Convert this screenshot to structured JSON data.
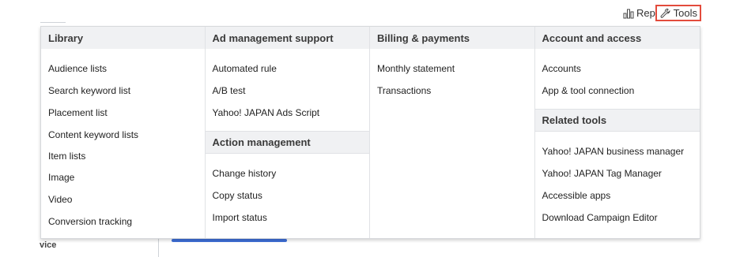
{
  "topbar": {
    "reports_label": "Reports",
    "tools_label": "Tools",
    "accent_color": "#e34b3c"
  },
  "background": {
    "bottom_fragment": "vice"
  },
  "menu": {
    "library": {
      "header": "Library",
      "items": [
        "Audience lists",
        "Search keyword list",
        "Placement list",
        "Content keyword lists",
        "Item lists",
        "Image",
        "Video",
        "Conversion tracking"
      ]
    },
    "ad_management": {
      "header": "Ad management support",
      "items": [
        "Automated rule",
        "A/B test",
        "Yahoo! JAPAN Ads Script"
      ],
      "sub_header": "Action management",
      "sub_items": [
        "Change history",
        "Copy status",
        "Import status"
      ]
    },
    "billing": {
      "header": "Billing & payments",
      "items": [
        "Monthly statement",
        "Transactions"
      ]
    },
    "account": {
      "header": "Account and access",
      "items": [
        "Accounts",
        "App & tool connection"
      ],
      "sub_header": "Related tools",
      "sub_items": [
        "Yahoo! JAPAN business manager",
        "Yahoo! JAPAN Tag Manager",
        "Accessible apps",
        "Download Campaign Editor"
      ]
    }
  }
}
